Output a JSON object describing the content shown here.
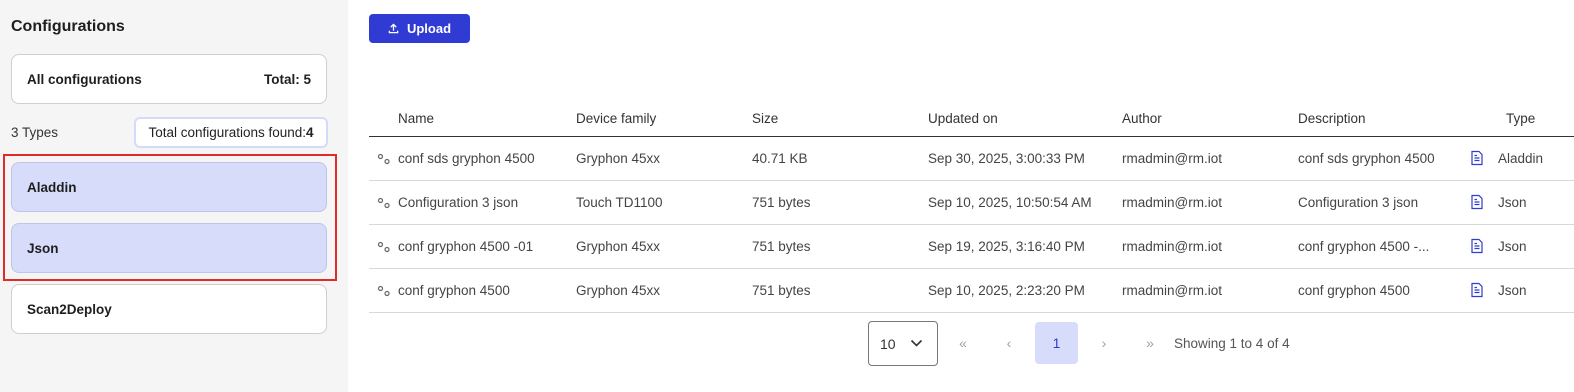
{
  "sidebar": {
    "title": "Configurations",
    "all_label": "All configurations",
    "total_label": "Total: 5",
    "types_count": "3 Types",
    "found_label": "Total configurations found:",
    "found_value": "4",
    "types": [
      {
        "label": "Aladdin",
        "selected": true
      },
      {
        "label": "Json",
        "selected": true
      },
      {
        "label": "Scan2Deploy",
        "selected": false
      }
    ]
  },
  "toolbar": {
    "upload_label": "Upload",
    "upload_icon": "upload-icon"
  },
  "table": {
    "columns": [
      "Name",
      "Device family",
      "Size",
      "Updated on",
      "Author",
      "Description",
      "Type"
    ],
    "rows": [
      {
        "name": "conf sds gryphon 4500",
        "device_family": "Gryphon 45xx",
        "size": "40.71 KB",
        "updated_on": "Sep 30, 2025, 3:00:33 PM",
        "author": "rmadmin@rm.iot",
        "description": "conf sds gryphon 4500",
        "type": "Aladdin"
      },
      {
        "name": "Configuration 3 json",
        "device_family": "Touch TD1100",
        "size": "751 bytes",
        "updated_on": "Sep 10, 2025, 10:50:54 AM",
        "author": "rmadmin@rm.iot",
        "description": "Configuration 3 json",
        "type": "Json"
      },
      {
        "name": "conf gryphon 4500 -01",
        "device_family": "Gryphon 45xx",
        "size": "751 bytes",
        "updated_on": "Sep 19, 2025, 3:16:40 PM",
        "author": "rmadmin@rm.iot",
        "description": "conf gryphon 4500 -...",
        "type": "Json"
      },
      {
        "name": "conf gryphon 4500",
        "device_family": "Gryphon 45xx",
        "size": "751 bytes",
        "updated_on": "Sep 10, 2025, 2:23:20 PM",
        "author": "rmadmin@rm.iot",
        "description": "conf gryphon 4500",
        "type": "Json"
      }
    ]
  },
  "pagination": {
    "page_size": "10",
    "first": "«",
    "prev": "‹",
    "current_page": "1",
    "next": "›",
    "last": "»",
    "showing": "Showing 1 to 4 of 4"
  },
  "colors": {
    "accent": "#2f3bd3",
    "selected_bg": "#d8dcfb",
    "highlight_border": "#e02b2b"
  }
}
